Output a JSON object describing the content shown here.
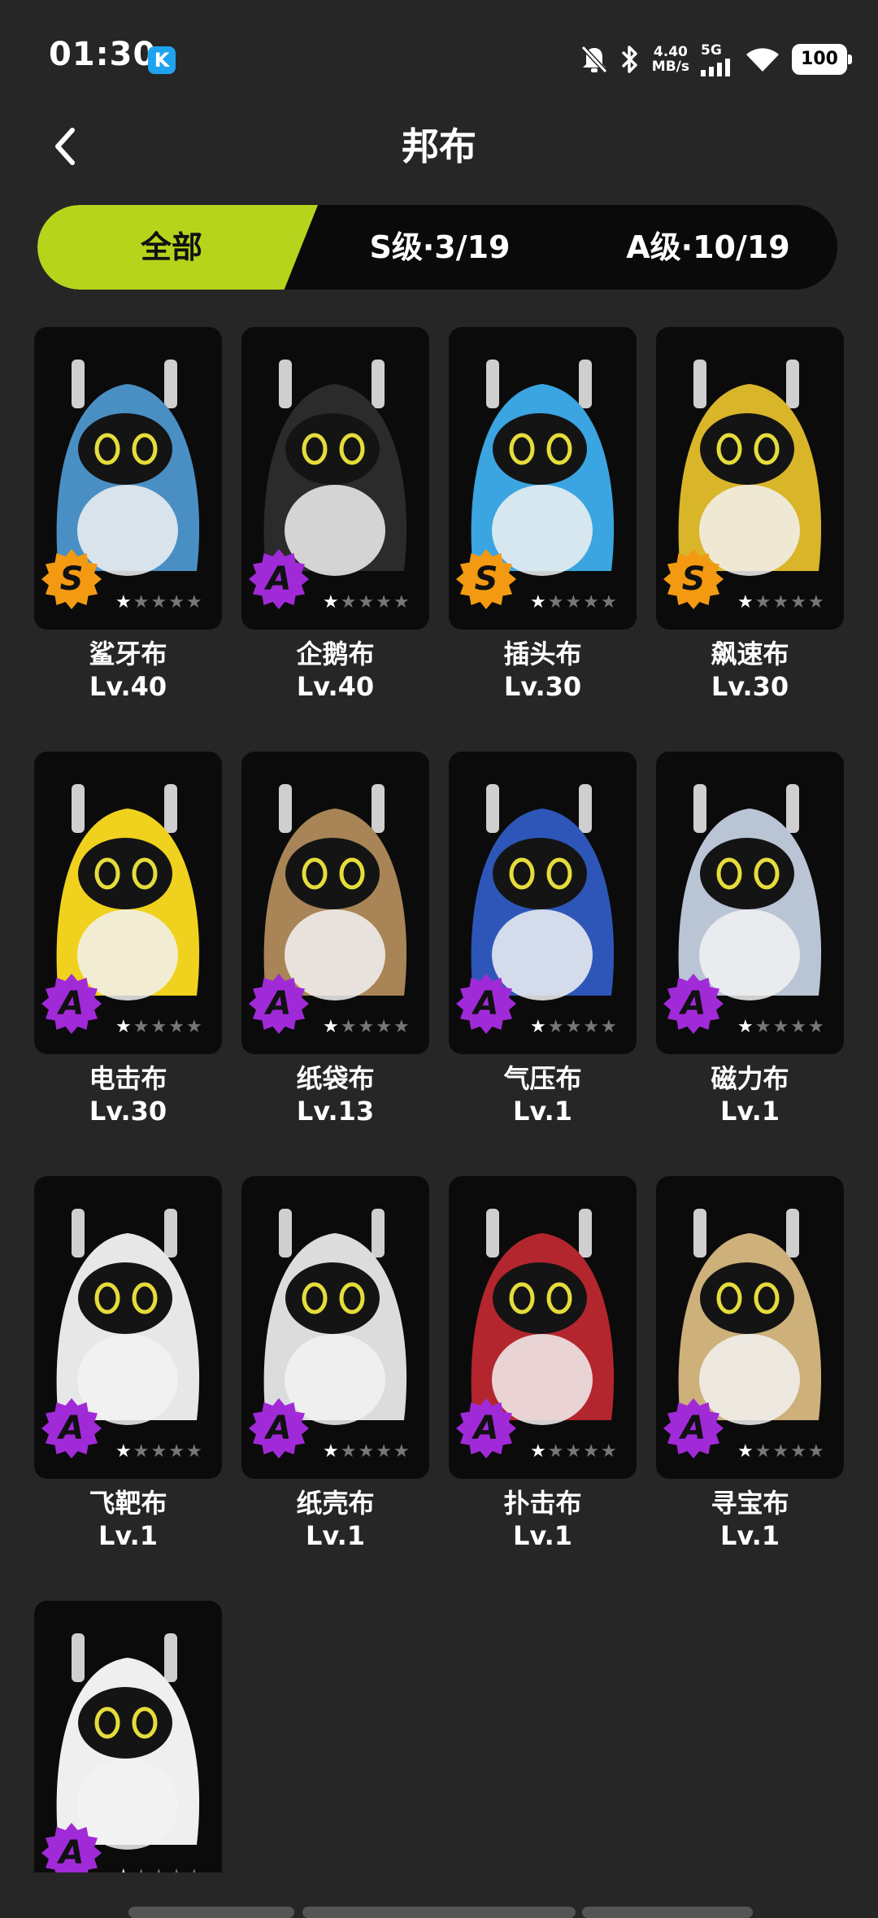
{
  "status_bar": {
    "time": "01:30",
    "app_badge": "K",
    "speed_top": "4.40",
    "speed_bottom": "MB/s",
    "network": "5G",
    "battery": "100"
  },
  "header": {
    "title": "邦布"
  },
  "tabs": [
    {
      "label": "全部",
      "active": true
    },
    {
      "label": "S级·3/19",
      "active": false
    },
    {
      "label": "A级·10/19",
      "active": false
    }
  ],
  "accent_color": "#b7d41c",
  "bangboos": [
    {
      "name": "鲨牙布",
      "level": "Lv.40",
      "rank": "S",
      "stars": 1,
      "icon": "shark-bangboo-icon",
      "color": "#4a8fc4"
    },
    {
      "name": "企鹅布",
      "level": "Lv.40",
      "rank": "A",
      "stars": 1,
      "icon": "penguin-bangboo-icon",
      "color": "#2b2b2b"
    },
    {
      "name": "插头布",
      "level": "Lv.30",
      "rank": "S",
      "stars": 1,
      "icon": "plug-bangboo-icon",
      "color": "#3aa5e0"
    },
    {
      "name": "飙速布",
      "level": "Lv.30",
      "rank": "S",
      "stars": 1,
      "icon": "racer-bangboo-icon",
      "color": "#d9b52a"
    },
    {
      "name": "电击布",
      "level": "Lv.30",
      "rank": "A",
      "stars": 1,
      "icon": "electro-bangboo-icon",
      "color": "#f0d21e"
    },
    {
      "name": "纸袋布",
      "level": "Lv.13",
      "rank": "A",
      "stars": 1,
      "icon": "paperbag-bangboo-icon",
      "color": "#a88456"
    },
    {
      "name": "气压布",
      "level": "Lv.1",
      "rank": "A",
      "stars": 1,
      "icon": "pressure-bangboo-icon",
      "color": "#2d56b8"
    },
    {
      "name": "磁力布",
      "level": "Lv.1",
      "rank": "A",
      "stars": 1,
      "icon": "magnet-bangboo-icon",
      "color": "#b9c4d4"
    },
    {
      "name": "飞靶布",
      "level": "Lv.1",
      "rank": "A",
      "stars": 1,
      "icon": "target-bangboo-icon",
      "color": "#e7e7e7"
    },
    {
      "name": "纸壳布",
      "level": "Lv.1",
      "rank": "A",
      "stars": 1,
      "icon": "cardboard-bangboo-icon",
      "color": "#dcdcdc"
    },
    {
      "name": "扑击布",
      "level": "Lv.1",
      "rank": "A",
      "stars": 1,
      "icon": "pounce-bangboo-icon",
      "color": "#b3262d"
    },
    {
      "name": "寻宝布",
      "level": "Lv.1",
      "rank": "A",
      "stars": 1,
      "icon": "treasure-bangboo-icon",
      "color": "#cdb07a"
    },
    {
      "name": "",
      "level": "",
      "rank": "A",
      "stars": 1,
      "icon": "bunny-bangboo-icon",
      "color": "#efefef"
    }
  ]
}
